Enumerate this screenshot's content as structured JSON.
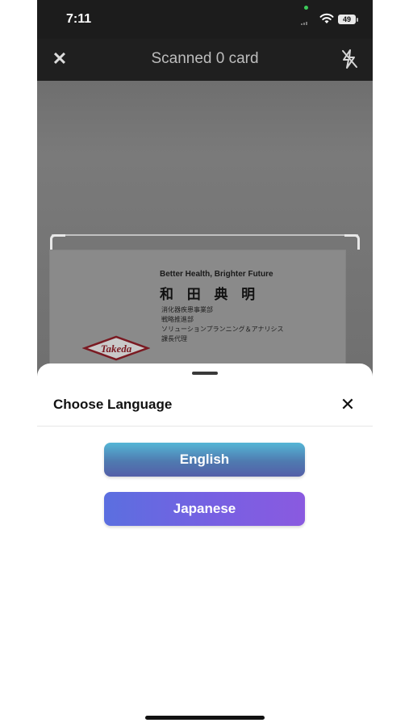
{
  "status_bar": {
    "time": "7:11",
    "battery": "49"
  },
  "nav": {
    "title": "Scanned 0 card"
  },
  "card": {
    "slogan": "Better Health, Brighter Future",
    "name": "和 田  典 明",
    "lines": [
      "消化器疾患事業部",
      "戦略推進部",
      "ソリューションプランニング＆アナリシス",
      "課長代理"
    ],
    "logo_text": "Takeda"
  },
  "sheet": {
    "title": "Choose Language",
    "buttons": {
      "english": "English",
      "japanese": "Japanese"
    }
  },
  "colors": {
    "accent_top": "#55b6d6",
    "accent_bottom": "#8a5ae0"
  },
  "icons": {
    "nav_close": "close-icon",
    "flash": "flash-off-icon",
    "sheet_close": "close-icon"
  }
}
